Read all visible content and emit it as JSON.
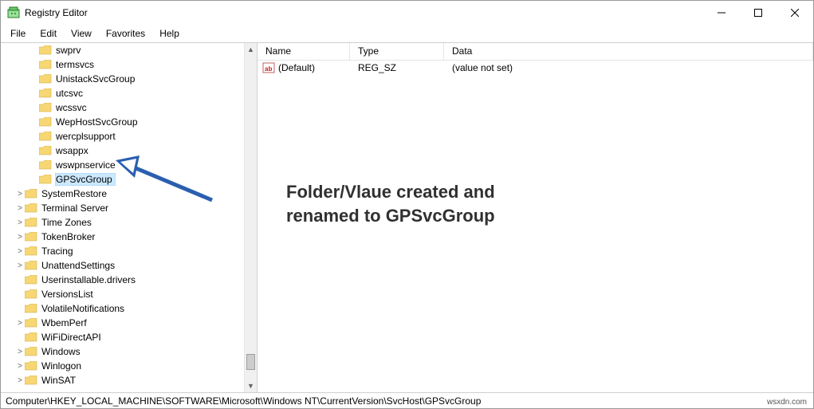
{
  "window": {
    "title": "Registry Editor"
  },
  "menu": {
    "file": "File",
    "edit": "Edit",
    "view": "View",
    "favorites": "Favorites",
    "help": "Help"
  },
  "tree": {
    "items_l3": [
      "swprv",
      "termsvcs",
      "UnistackSvcGroup",
      "utcsvc",
      "wcssvc",
      "WepHostSvcGroup",
      "wercplsupport",
      "wsappx",
      "wswpnservice",
      "GPSvcGroup"
    ],
    "items_l2": [
      "SystemRestore",
      "Terminal Server",
      "Time Zones",
      "TokenBroker",
      "Tracing",
      "UnattendSettings",
      "Userinstallable.drivers",
      "VersionsList",
      "VolatileNotifications",
      "WbemPerf",
      "WiFiDirectAPI",
      "Windows",
      "Winlogon",
      "WinSAT"
    ],
    "selected": "GPSvcGroup"
  },
  "list": {
    "headers": {
      "name": "Name",
      "type": "Type",
      "data": "Data"
    },
    "rows": [
      {
        "name": "(Default)",
        "type": "REG_SZ",
        "data": "(value not set)"
      }
    ]
  },
  "annotation": {
    "line1": "Folder/Vlaue created and",
    "line2": "renamed to GPSvcGroup"
  },
  "statusbar": {
    "path": "Computer\\HKEY_LOCAL_MACHINE\\SOFTWARE\\Microsoft\\Windows NT\\CurrentVersion\\SvcHost\\GPSvcGroup"
  },
  "watermark": "wsxdn.com"
}
